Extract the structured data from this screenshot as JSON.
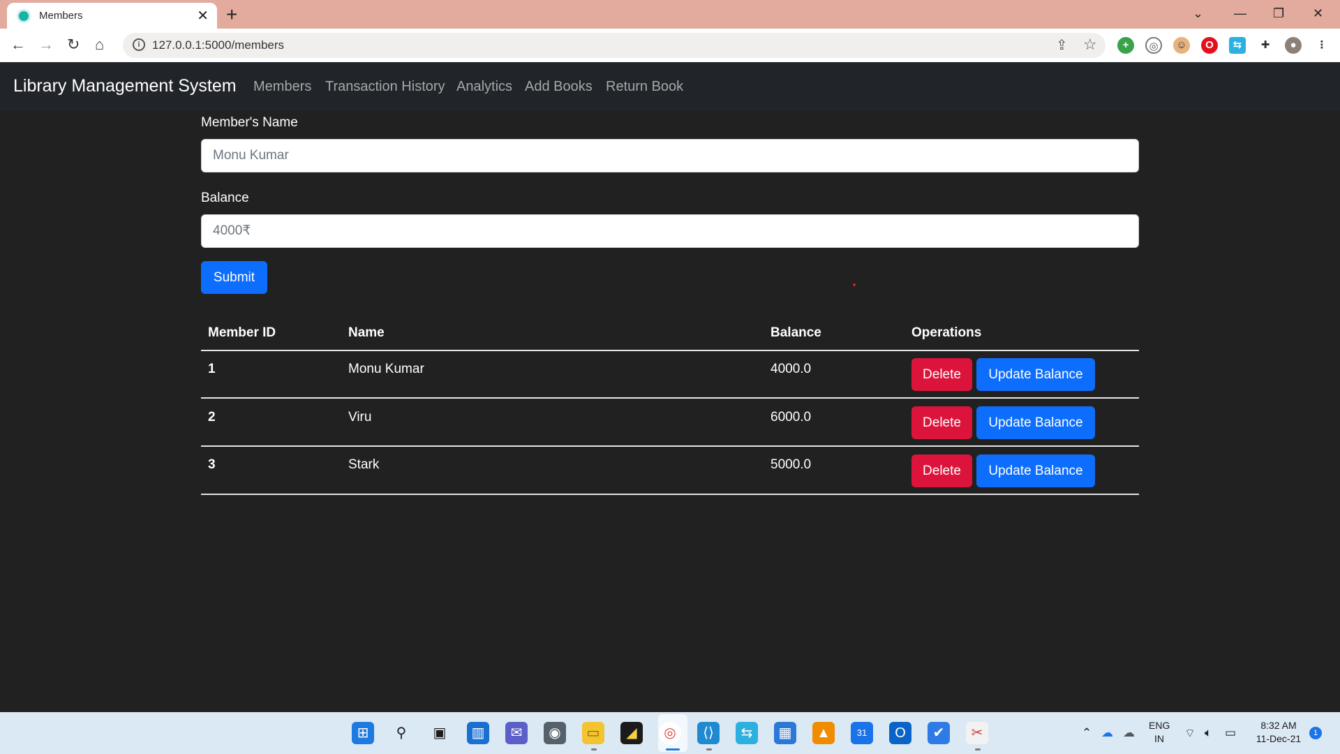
{
  "browser": {
    "tab_title": "Members",
    "new_tab": "+",
    "tab_close": "✕",
    "url": "127.0.0.1:5000/members",
    "window_controls": {
      "chevron": "⌄",
      "minimize": "—",
      "restore": "❐",
      "close": "✕"
    }
  },
  "navbar": {
    "brand": "Library Management System",
    "links": [
      "Members",
      "Transaction History",
      "Analytics",
      "Add Books",
      "Return Book"
    ]
  },
  "form": {
    "name_label": "Member's Name",
    "name_placeholder": "Monu Kumar",
    "balance_label": "Balance",
    "balance_placeholder": "4000₹",
    "submit_label": "Submit"
  },
  "table": {
    "headers": [
      "Member ID",
      "Name",
      "Balance",
      "Operations"
    ],
    "rows": [
      {
        "id": "1",
        "name": "Monu Kumar",
        "balance": "4000.0"
      },
      {
        "id": "2",
        "name": "Viru",
        "balance": "6000.0"
      },
      {
        "id": "3",
        "name": "Stark",
        "balance": "5000.0"
      }
    ],
    "delete_label": "Delete",
    "update_label": "Update Balance"
  },
  "taskbar": {
    "language": "ENG",
    "region": "IN",
    "time": "8:32 AM",
    "date": "11-Dec-21",
    "notification_count": "1"
  },
  "colors": {
    "page_bg": "#212121",
    "navbar_bg": "#212529",
    "primary": "#0d6efd",
    "danger": "#dc143c",
    "tabstrip": "#e3ab9e"
  },
  "icons": {
    "ext_1": "plus-circle-icon",
    "ext_2": "ghost-icon",
    "ext_3": "face-icon",
    "ext_4": "opera-icon",
    "ext_5": "translate-icon",
    "ext_6": "puzzle-icon",
    "profile": "avatar-icon"
  }
}
